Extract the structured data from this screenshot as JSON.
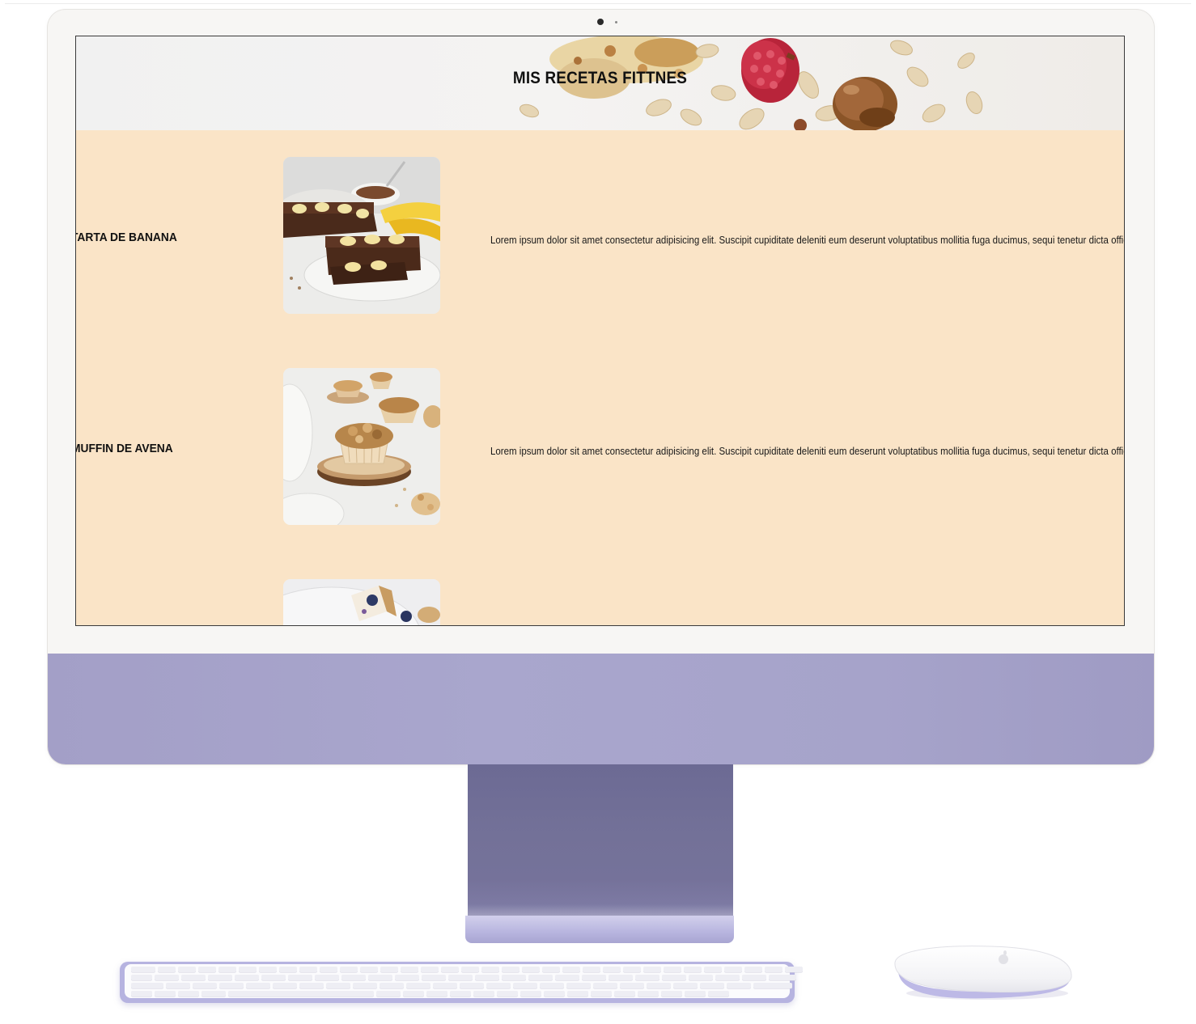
{
  "screen": {
    "title": "MIS RECETAS FITTNES",
    "recipes": [
      {
        "name": "TARTA DE BANANA",
        "description": "Lorem ipsum dolor sit amet consectetur adipisicing elit. Suscipit cupiditate deleniti eum deserunt voluptatibus mollitia fuga ducimus, sequi tenetur dicta officia",
        "image": "banana-cake-photo"
      },
      {
        "name": "MUFFIN DE AVENA",
        "description": "Lorem ipsum dolor sit amet consectetur adipisicing elit. Suscipit cupiditate deleniti eum deserunt voluptatibus mollitia fuga ducimus, sequi tenetur dicta officia",
        "image": "oat-muffin-photo"
      },
      {
        "name": "",
        "description": "",
        "image": "yogurt-bar-photo"
      }
    ]
  },
  "colors": {
    "content_background": "#fae4c7",
    "device_purple": "#a6a3ca",
    "stand_purple": "#737198"
  }
}
